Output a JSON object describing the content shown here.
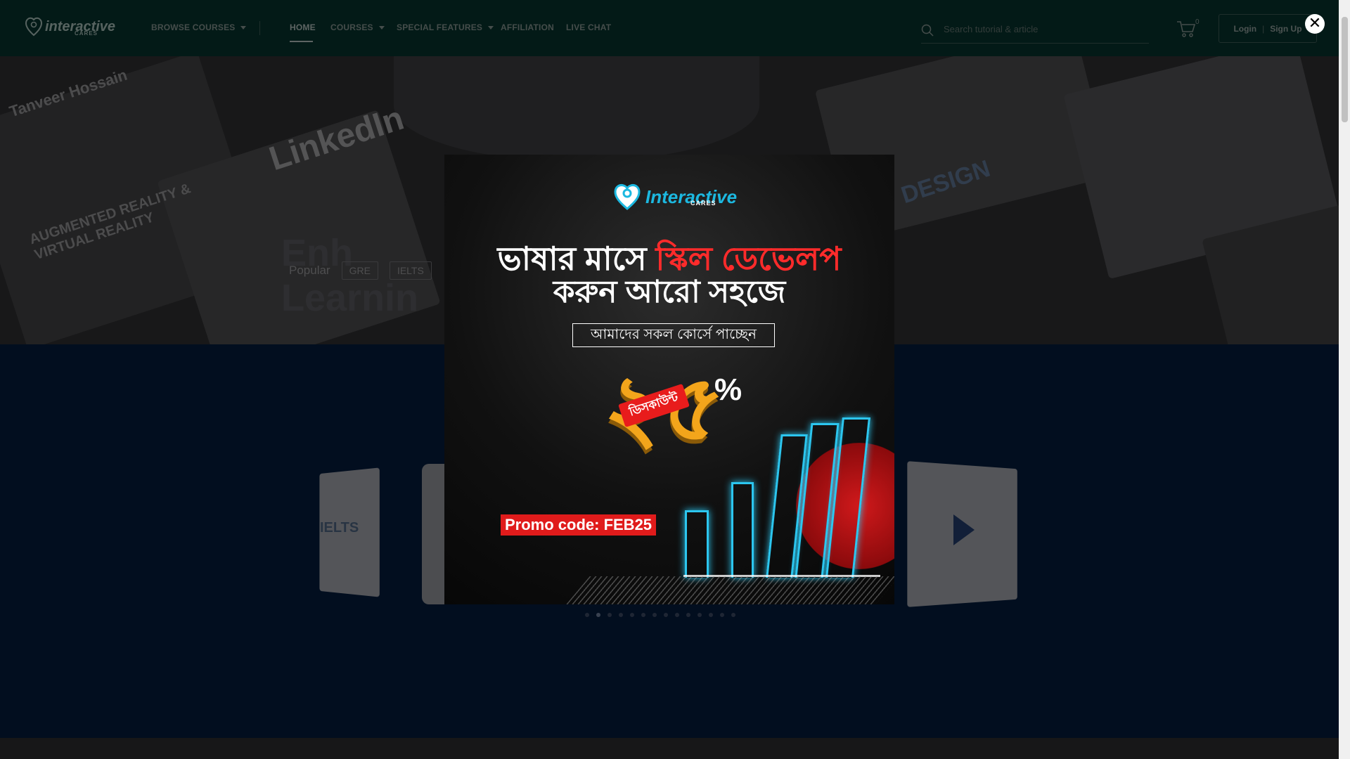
{
  "navbar": {
    "logo_text": "interactive",
    "logo_sub": "CARES",
    "browse_label": "BROWSE COURSES",
    "items": [
      {
        "label": "HOME"
      },
      {
        "label": "COURSES"
      },
      {
        "label": "SPECIAL FEATURES"
      },
      {
        "label": "AFFILIATION"
      },
      {
        "label": "LIVE CHAT"
      }
    ],
    "active_item": "HOME",
    "search_placeholder": "Search tutorial & article",
    "cart_count": "0",
    "login_label": "Login",
    "auth_separator": "|",
    "signup_label": "Sign Up"
  },
  "hero": {
    "heading_line1": "Enh",
    "heading_line2": "Learnin",
    "popular_label": "Popular",
    "tags": [
      "GRE",
      "IELTS"
    ],
    "card_texts": [
      "Tanveer Hossain",
      "LinkedIn",
      "AUGMENTED REALITY & VIRTUAL REALITY",
      "DESIGN"
    ]
  },
  "slider": {
    "ielts_label": "IELTS",
    "dot_count": 14,
    "active_dot": 1
  },
  "modal": {
    "logo_text": "Interactive",
    "logo_sub": "CARES",
    "headline_part1": "ভাষার মাসে ",
    "headline_highlight": "স্কিল ডেভেলপ",
    "headline_line2": "করুন আরো সহজে",
    "subline": "আমাদের সকল কোর্সে পাচ্ছেন",
    "discount_number": "২৫",
    "discount_label": "ডিসকাউন্ট",
    "percent_sign": "%",
    "promo_text": "Promo code: FEB25",
    "close_icon": "close-icon"
  },
  "colors": {
    "nav_bg": "#06302a",
    "hero_bg": "#2c2c2e",
    "blue_bg": "#041a3a",
    "accent_red": "#e01b1b",
    "accent_cyan": "#2cc6ef",
    "discount_orange": "#f3a51b"
  }
}
